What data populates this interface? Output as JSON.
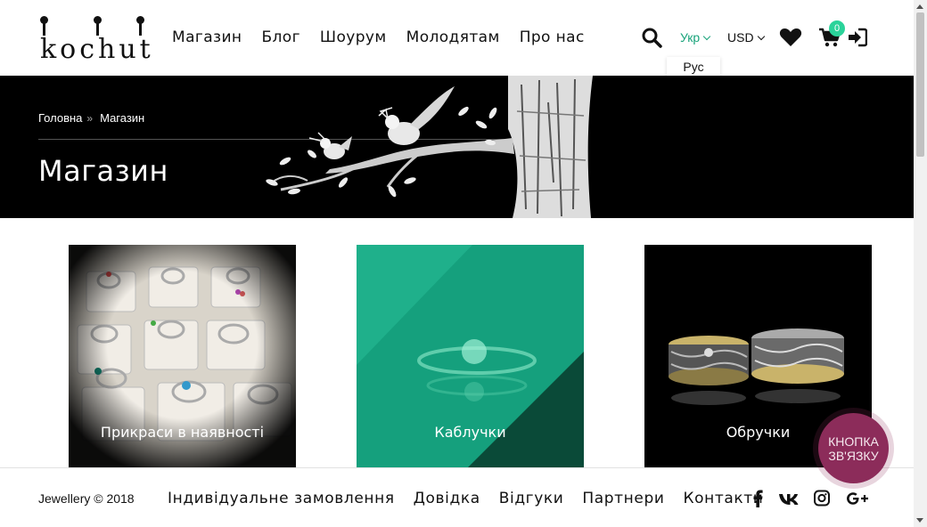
{
  "brand": {
    "logo_text": "kochut"
  },
  "nav": {
    "items": [
      {
        "label": "Магазин"
      },
      {
        "label": "Блог"
      },
      {
        "label": "Шоурум"
      },
      {
        "label": "Молодятам"
      },
      {
        "label": "Про нас"
      }
    ]
  },
  "header": {
    "language": "Укр",
    "language_option": "Рус",
    "currency": "USD",
    "cart_count": "0",
    "accent_color": "#18a37a"
  },
  "banner": {
    "breadcrumb": [
      "Головна",
      "Магазин"
    ],
    "title": "Магазин"
  },
  "categories": [
    {
      "label": "Прикраси в наявності"
    },
    {
      "label": "Каблучки"
    },
    {
      "label": "Обручки"
    }
  ],
  "footer": {
    "copyright": "Jewellery © 2018",
    "links": [
      {
        "label": "Індивідуальне замовлення"
      },
      {
        "label": "Довідка"
      },
      {
        "label": "Відгуки"
      },
      {
        "label": "Партнери"
      },
      {
        "label": "Контакти"
      }
    ],
    "social_icons": [
      "facebook-icon",
      "vk-icon",
      "instagram-icon",
      "google-plus-icon"
    ]
  },
  "contact_button": {
    "line1": "КНОПКА",
    "line2": "ЗВ'ЯЗКУ",
    "color": "#8c2c5a"
  }
}
